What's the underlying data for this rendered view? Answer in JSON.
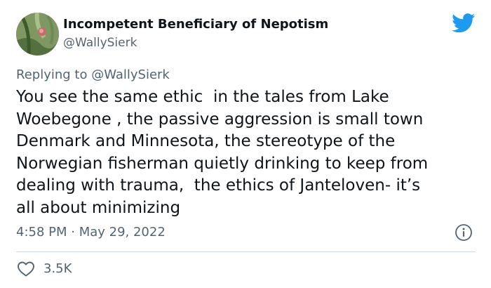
{
  "author": {
    "display_name": "Incompetent Beneficiary of Nepotism",
    "handle": "@WallySierk",
    "avatar_icon": "avatar-photo"
  },
  "reply": {
    "prefix": "Replying to ",
    "mention": "@WallySierk"
  },
  "tweet": {
    "text": "You see the same ethic  in the tales from Lake\nWoebegone , the passive aggression is small town\nDenmark and Minnesota, the stereotype of the\nNorwegian fisherman quietly drinking to keep from\ndealing with trauma,  the ethics of Janteloven- it’s\nall about minimizing",
    "timestamp": "4:58 PM · May 29, 2022"
  },
  "engagement": {
    "likes": "3.5K"
  },
  "icons": {
    "brand": "twitter-bird-icon",
    "info": "info-icon",
    "like": "heart-icon"
  },
  "colors": {
    "brand_blue": "#1d9bf0",
    "secondary_text": "#536471",
    "primary_text": "#0f1419",
    "divider": "#cfd9de"
  }
}
